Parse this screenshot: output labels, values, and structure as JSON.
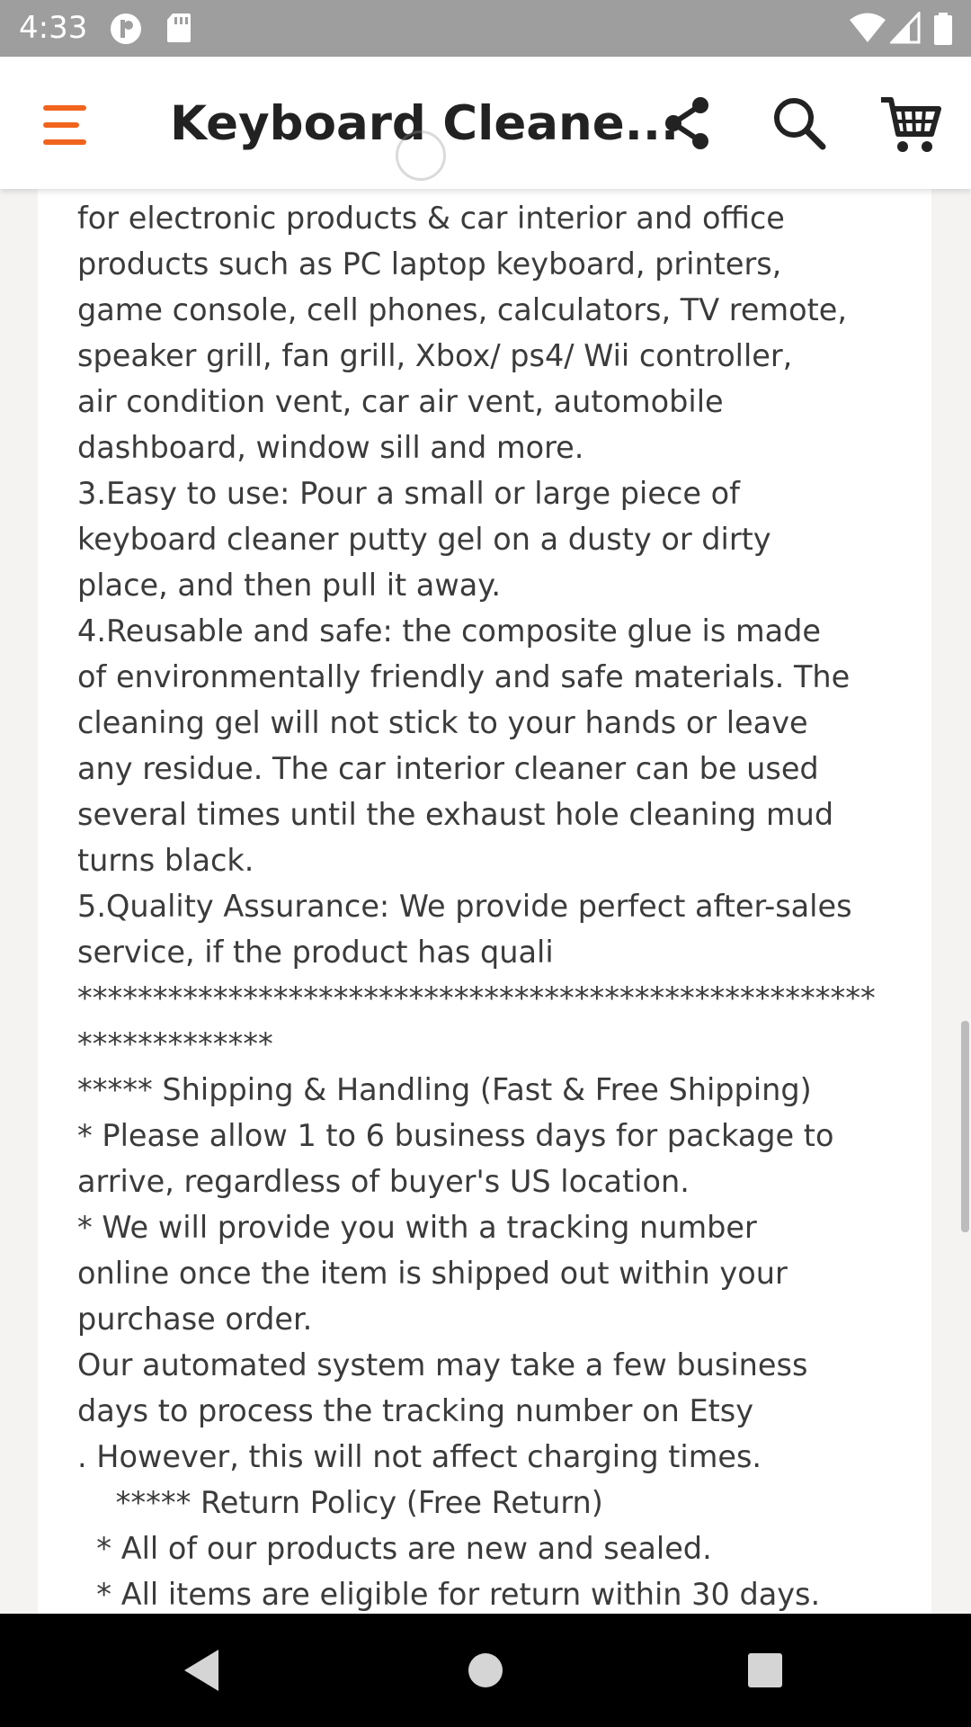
{
  "status_bar": {
    "time": "4:33"
  },
  "app_bar": {
    "title": "Keyboard Cleane...",
    "accent_color": "#f1641e",
    "icons": [
      "menu-icon",
      "share-icon",
      "search-icon",
      "cart-icon"
    ]
  },
  "description": {
    "lines": [
      "for electronic products & car interior and office",
      "products such as PC laptop keyboard, printers,",
      "game console, cell phones, calculators, TV remote,",
      "speaker grill, fan grill, Xbox/ ps4/ Wii controller,",
      "air condition vent, car air vent, automobile",
      "dashboard, window sill and more.",
      "3.Easy to use: Pour a small or large piece of",
      "keyboard cleaner putty gel on a dusty or dirty",
      "place, and then pull it away.",
      "4.Reusable and safe: the composite glue is made",
      "of environmentally friendly and safe materials. The",
      "cleaning gel will not stick to your hands or leave",
      "any residue. The car interior cleaner can be used",
      "several times until the exhaust hole cleaning mud",
      "turns black.",
      "5.Quality Assurance: We provide perfect after-sales",
      "service, if the product has quali",
      "*****************************************************",
      "*************",
      "***** Shipping & Handling (Fast & Free Shipping)",
      "* Please allow 1 to 6 business days for package to",
      "arrive, regardless of buyer's US location.",
      "* We will provide you with a tracking number",
      "online once the item is shipped out within your",
      "purchase order.",
      "Our automated system may take a few business",
      "days to process the tracking number on Etsy",
      ". However, this will not affect charging times.",
      "    ***** Return Policy (Free Return)",
      "  * All of our products are new and sealed.",
      "  * All items are eligible for return within 30 days."
    ]
  },
  "nav_bar": {
    "icons": [
      "back-icon",
      "home-icon",
      "recents-icon"
    ]
  }
}
